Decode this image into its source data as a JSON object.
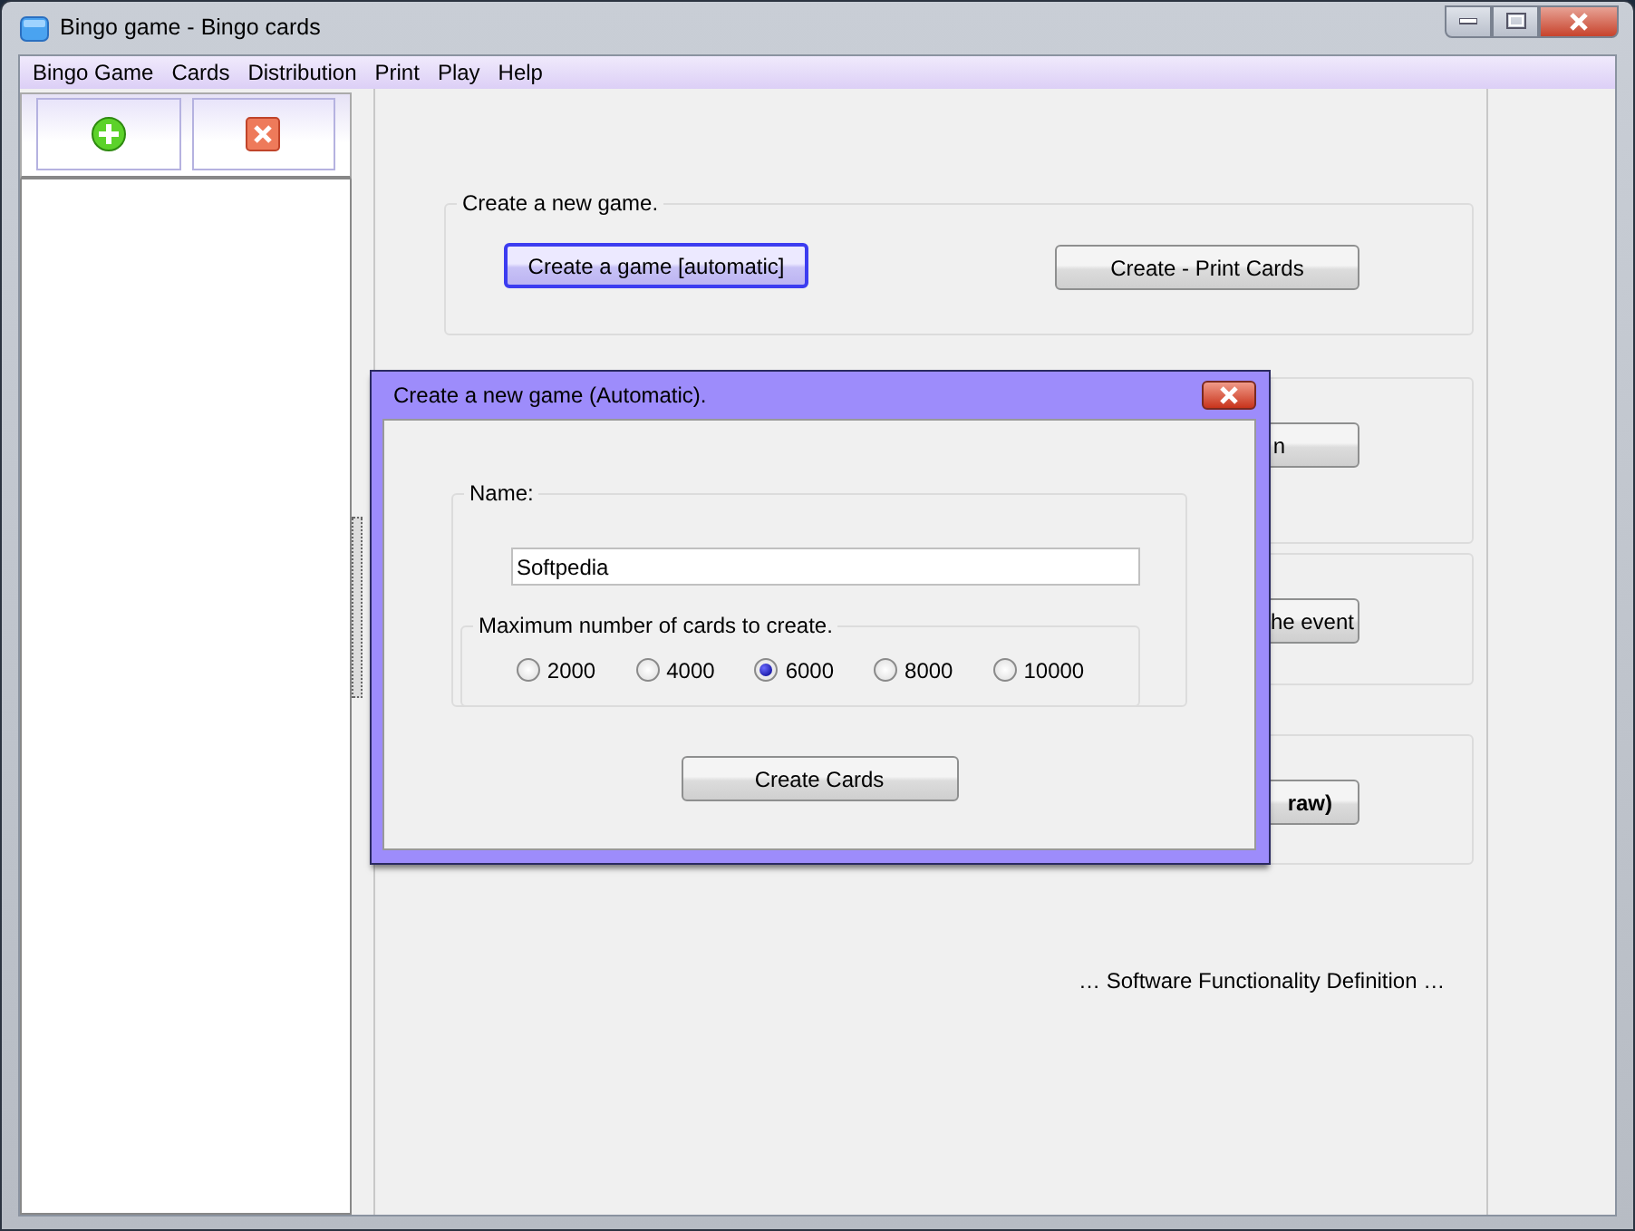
{
  "window": {
    "title": "Bingo game - Bingo cards"
  },
  "menu": [
    "Bingo Game",
    "Cards",
    "Distribution",
    "Print",
    "Play",
    "Help"
  ],
  "toolbar": [
    {
      "kind": "add"
    },
    {
      "kind": "delete"
    }
  ],
  "sections": [
    {
      "legend": "Create a new game.",
      "buttons": [
        {
          "label": "Create a game [automatic]",
          "focused": true,
          "bold": false
        },
        {
          "label": "Create - Print Cards",
          "focused": false,
          "bold": false
        }
      ]
    },
    {
      "buttons": [
        {
          "label": "n",
          "focused": false,
          "bold": false
        }
      ]
    },
    {
      "buttons": [
        {
          "label": "he event",
          "focused": false,
          "bold": false
        }
      ]
    },
    {
      "buttons": [
        {
          "label": "raw)",
          "focused": false,
          "bold": true
        }
      ]
    }
  ],
  "footer_text": "… Software Functionality Definition …",
  "dialog": {
    "title": "Create a new game (Automatic).",
    "name_label": "Name:",
    "name_value": "Softpedia",
    "max_label": "Maximum number of cards to create.",
    "options": [
      {
        "label": "2000",
        "selected": false
      },
      {
        "label": "4000",
        "selected": false
      },
      {
        "label": "6000",
        "selected": true
      },
      {
        "label": "8000",
        "selected": false
      },
      {
        "label": "10000",
        "selected": false
      }
    ],
    "button": "Create Cards"
  }
}
